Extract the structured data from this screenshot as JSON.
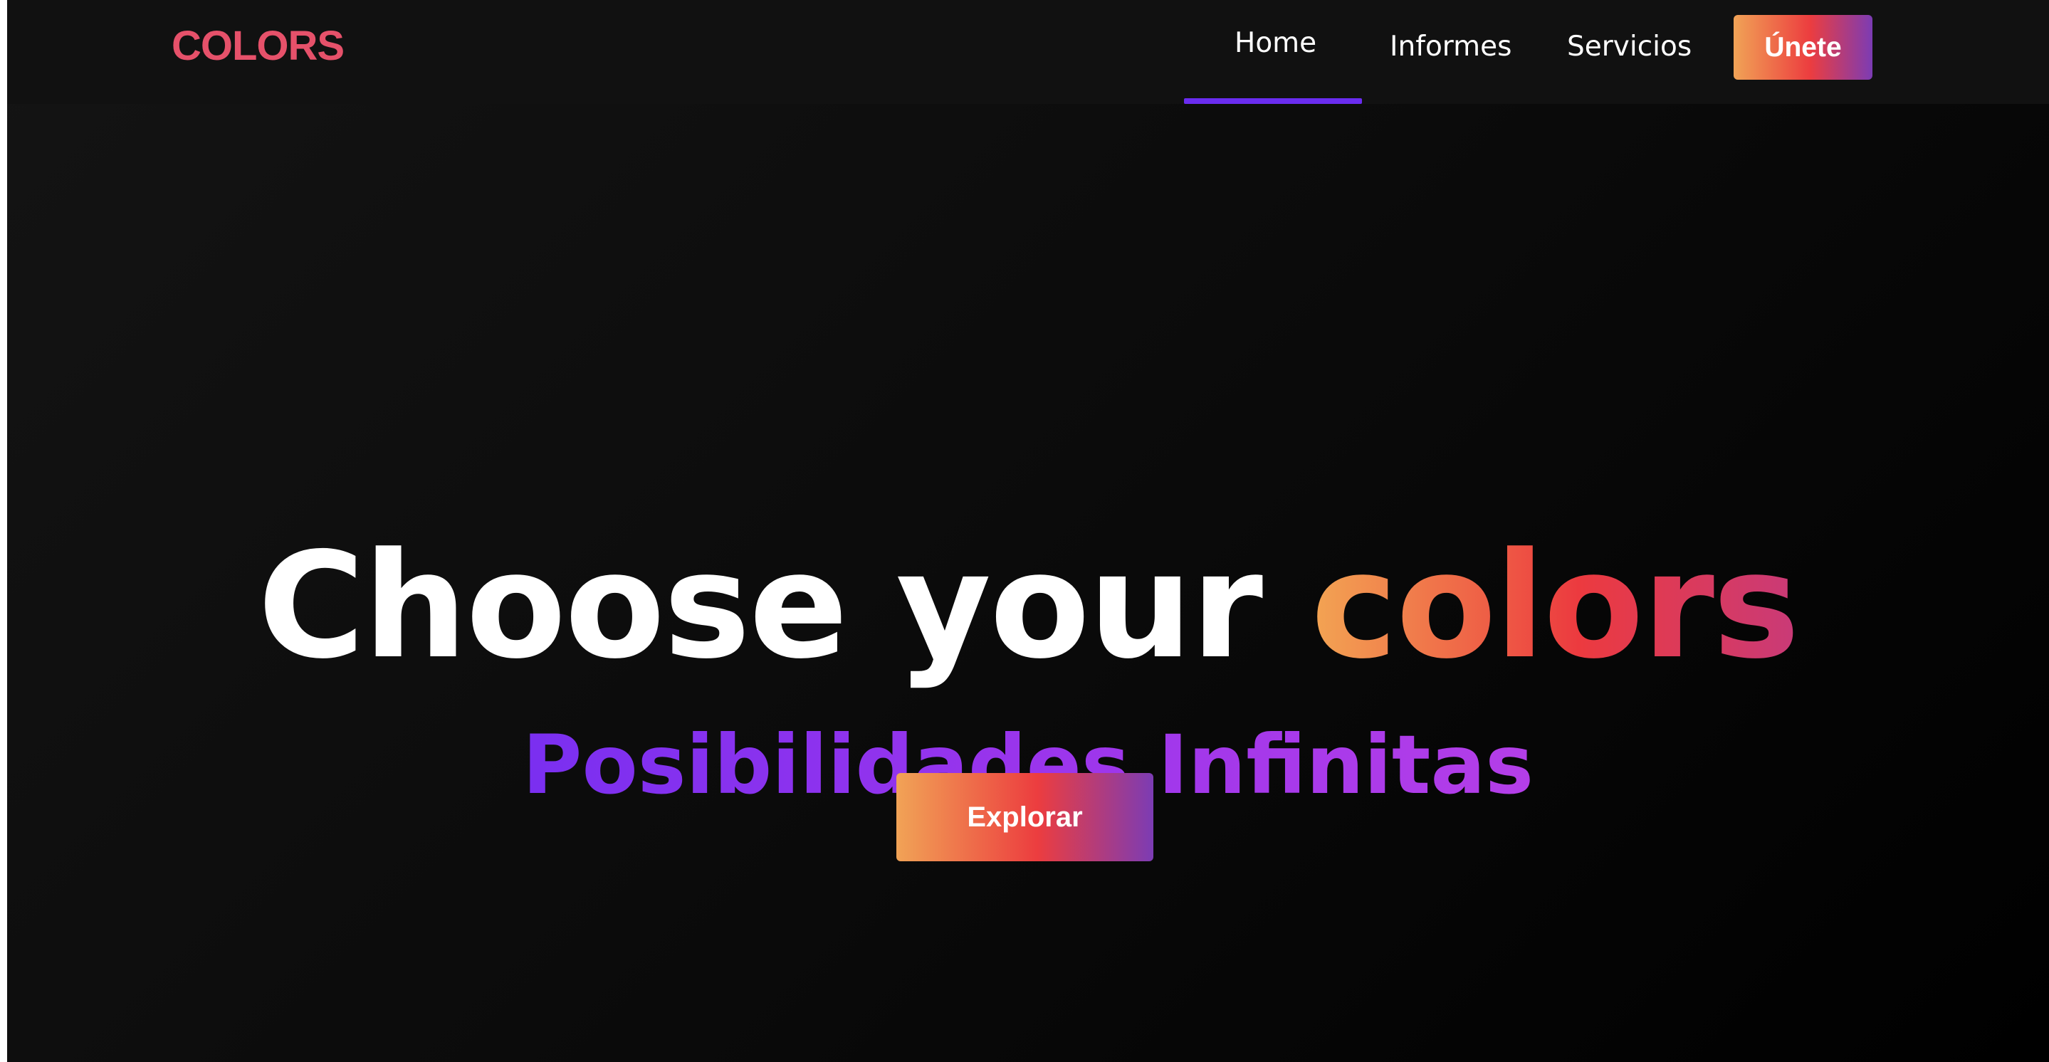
{
  "brand": {
    "name": "COLORS",
    "color": "#e6516a"
  },
  "nav": {
    "items": [
      {
        "label": "Home",
        "active": true
      },
      {
        "label": "Informes",
        "active": false
      },
      {
        "label": "Servicios",
        "active": false
      }
    ],
    "join_label": "Únete",
    "active_indicator_color": "#6a2cf0"
  },
  "hero": {
    "title_main": "Choose your",
    "title_accent": "colors",
    "subtitle": "Posibilidades Infinitas",
    "cta_label": "Explorar"
  },
  "colors": {
    "gradient_start": "#f1a356",
    "gradient_mid": "#ec3d3f",
    "gradient_end": "#7c3cb4",
    "subtitle_gradient_start": "#7a2ff0",
    "subtitle_gradient_end": "#b43ee8",
    "background": "#0b0b0b",
    "navbar_background": "#111111"
  }
}
